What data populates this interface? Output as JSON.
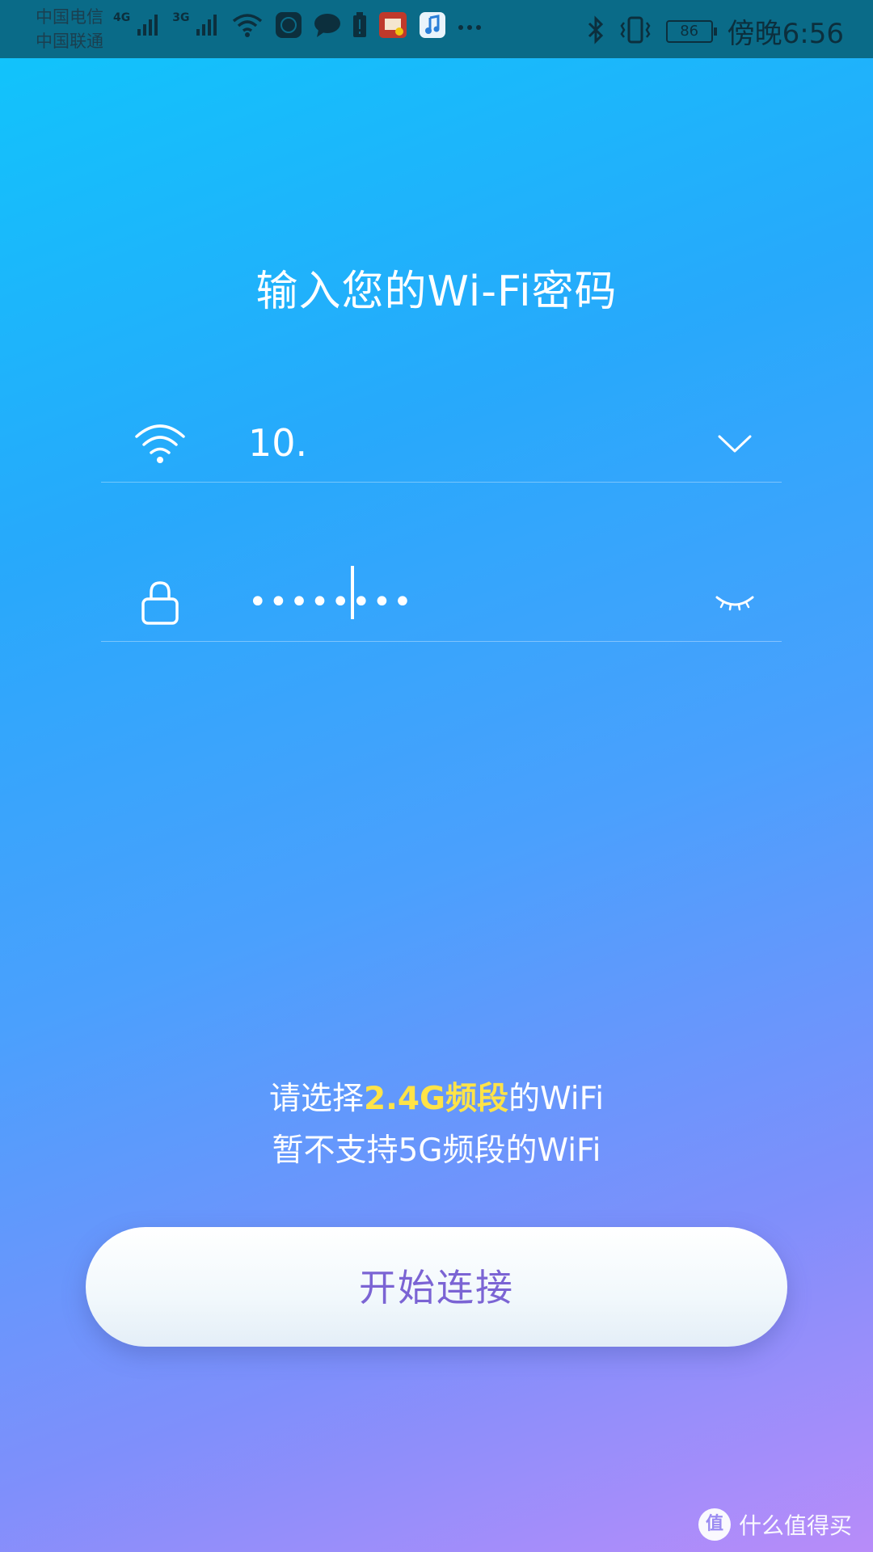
{
  "status_bar": {
    "carrier_1": "中国电信",
    "carrier_2": "中国联通",
    "net_1": "4G",
    "net_2": "3G",
    "battery": "86",
    "time": "傍晚6:56",
    "icons": [
      "signal-icon",
      "wifi-icon",
      "speed-icon",
      "message-icon",
      "battery-alert-icon",
      "app-icon",
      "music-icon",
      "more-icon",
      "bluetooth-icon",
      "vibrate-icon"
    ]
  },
  "title": "输入您的Wi-Fi密码",
  "wifi_row": {
    "icon": "wifi-icon",
    "ssid": "10.",
    "dropdown_icon": "chevron-down-icon"
  },
  "password_row": {
    "icon": "lock-icon",
    "value": "••••••••",
    "toggle_icon": "eye-closed-icon"
  },
  "notice": {
    "line1_pre": "请选择",
    "line1_highlight": "2.4G频段",
    "line1_post": "的WiFi",
    "line2": "暂不支持5G频段的WiFi"
  },
  "connect_button": "开始连接",
  "watermark": {
    "logo": "值",
    "text": "什么值得买"
  },
  "colors": {
    "highlight": "#ffe347",
    "button_text": "#7b64d4",
    "background_top": "#0fc6fb",
    "background_bottom": "#b88cf9"
  }
}
